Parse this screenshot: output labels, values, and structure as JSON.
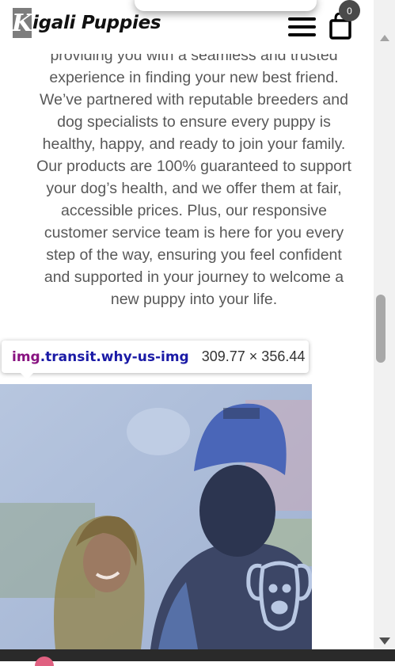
{
  "header": {
    "logo_letter": "K",
    "logo_text": "igali Puppies",
    "cart_count": "0"
  },
  "content": {
    "paragraph_lines": [
      "providing you with a seamless and trusted",
      "experience in finding your new best friend.",
      "We’ve partnered with reputable breeders and",
      "dog specialists to ensure every puppy is",
      "healthy, happy, and ready to join your family.",
      "Our products are 100% guaranteed to support",
      "your dog’s health, and we offer them at fair,",
      "accessible prices. Plus, our responsive",
      "customer service team is here for you every",
      "step of the way, ensuring you feel confident",
      "and supported in your journey to welcome a",
      "new puppy into your life."
    ]
  },
  "devtools_tooltip": {
    "tag": "img",
    "class_name": ".transit.why-us-img",
    "dimensions": "309.77 × 356.44"
  },
  "colors": {
    "text": "#585858",
    "tooltip_tag": "#881280",
    "tooltip_class": "#1a1aa6",
    "overlay": "#a9b9d6"
  },
  "icons": [
    "hamburger-menu-icon",
    "shopping-bag-icon",
    "dog-face-icon"
  ]
}
